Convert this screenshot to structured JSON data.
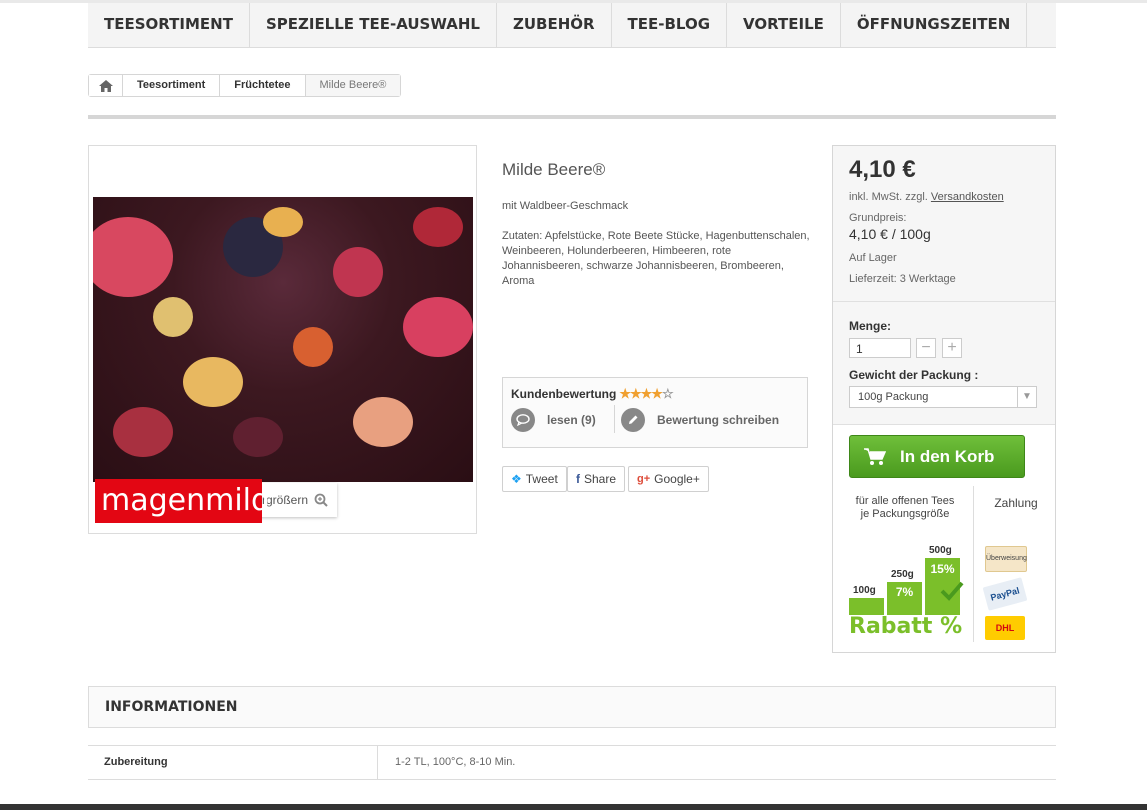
{
  "nav": {
    "items": [
      "TEESORTIMENT",
      "SPEZIELLE TEE-AUSWAHL",
      "ZUBEHÖR",
      "TEE-BLOG",
      "VORTEILE",
      "ÖFFNUNGSZEITEN"
    ]
  },
  "breadcrumb": {
    "items": [
      "Teesortiment",
      "Früchtetee",
      "Milde Beere®"
    ]
  },
  "image": {
    "zoom_label": "Vergrößern",
    "brand_text": "magenmild"
  },
  "product": {
    "title": "Milde Beere®",
    "subtitle": "mit Waldbeer-Geschmack",
    "ingredients": "Zutaten: Apfelstücke, Rote Beete Stücke, Hagenbuttenschalen, Weinbeeren, Holunderbeeren, Himbeeren, rote Johannisbeeren, schwarze Johannisbeeren, Brombeeren, Aroma"
  },
  "review": {
    "title": "Kundenbewertung",
    "rating": 4,
    "max_rating": 5,
    "read_label": "lesen (9)",
    "write_label": "Bewertung schreiben"
  },
  "share": {
    "tweet": "Tweet",
    "share": "Share",
    "google": "Google+"
  },
  "buy": {
    "price": "4,10 €",
    "tax_text": "inkl. MwSt. zzgl.",
    "shipping_link": "Versandkosten",
    "base_price_label": "Grundpreis:",
    "base_price": "4,10 € / 100g",
    "stock": "Auf Lager",
    "delivery": "Lieferzeit: 3 Werktage",
    "qty_label": "Menge:",
    "qty_value": "1",
    "minus": "−",
    "plus": "+",
    "weight_label": "Gewicht der Packung :",
    "weight_selected": "100g Packung",
    "cart_label": "In den Korb"
  },
  "promo": {
    "heading": "für alle offenen Tees je Packungsgröße",
    "payment_heading": "Zahlung",
    "tiers": [
      {
        "label": "100g",
        "discount": ""
      },
      {
        "label": "250g",
        "discount": "7%"
      },
      {
        "label": "500g",
        "discount": "15%"
      }
    ],
    "rabatt": "Rabatt %",
    "payments": [
      "Überweisung",
      "PayPal",
      "DHL"
    ]
  },
  "info": {
    "heading": "INFORMATIONEN",
    "rows": [
      {
        "key": "Zubereitung",
        "value": "1-2 TL, 100°C, 8-10 Min."
      }
    ]
  },
  "colors": {
    "accent_green": "#6fbf3a",
    "brand_red": "#e30613",
    "star": "#f0a030"
  }
}
